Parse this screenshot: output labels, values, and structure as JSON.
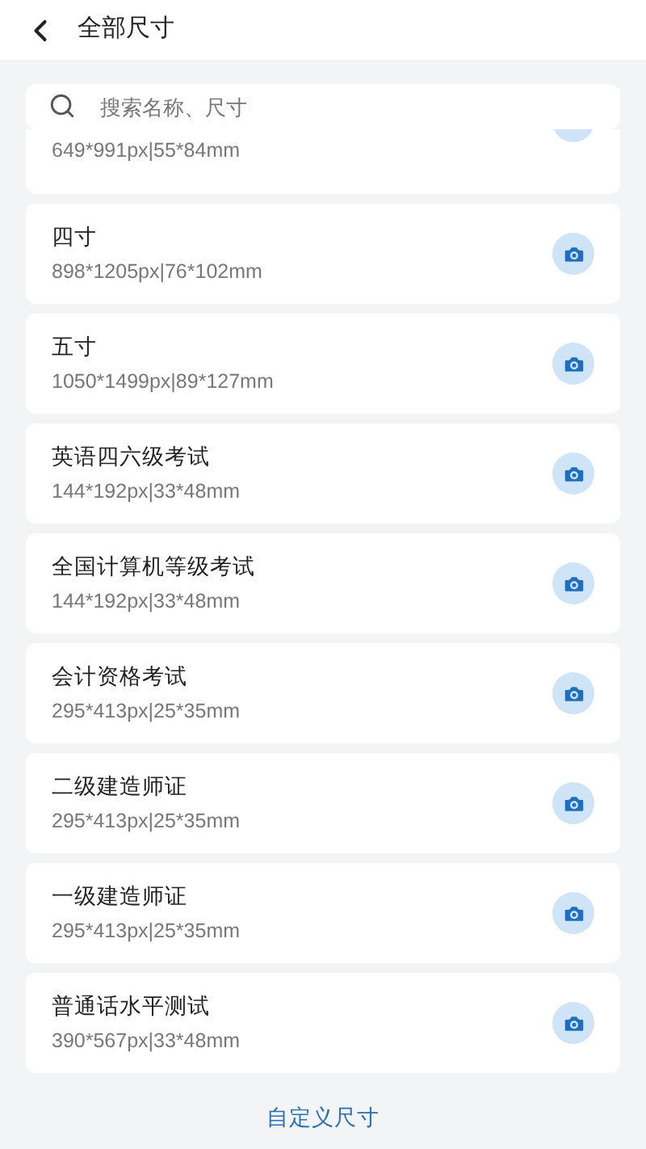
{
  "header": {
    "title": "全部尺寸"
  },
  "search": {
    "placeholder": "搜索名称、尺寸"
  },
  "sizes": [
    {
      "size": "649*991px|55*84mm",
      "partial": true
    },
    {
      "name": "四寸",
      "size": "898*1205px|76*102mm",
      "partial": false
    },
    {
      "name": "五寸",
      "size": "1050*1499px|89*127mm",
      "partial": false
    },
    {
      "name": "英语四六级考试",
      "size": "144*192px|33*48mm",
      "partial": false
    },
    {
      "name": "全国计算机等级考试",
      "size": "144*192px|33*48mm",
      "partial": false
    },
    {
      "name": "会计资格考试",
      "size": "295*413px|25*35mm",
      "partial": false
    },
    {
      "name": "二级建造师证",
      "size": "295*413px|25*35mm",
      "partial": false
    },
    {
      "name": "一级建造师证",
      "size": "295*413px|25*35mm",
      "partial": false
    },
    {
      "name": "普通话水平测试",
      "size": "390*567px|33*48mm",
      "partial": false
    }
  ],
  "custom_link": "自定义尺寸"
}
